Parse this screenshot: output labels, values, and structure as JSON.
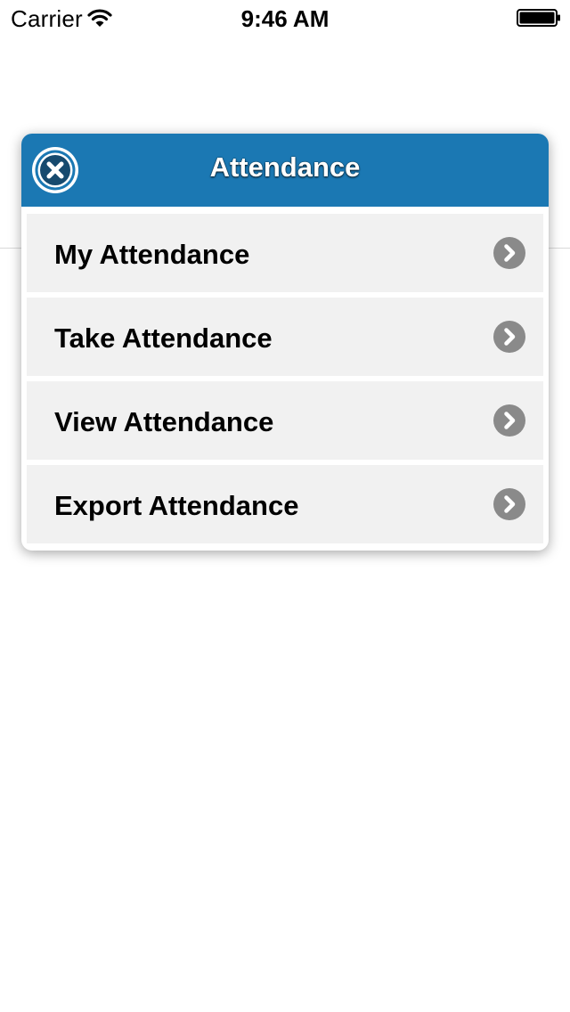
{
  "status_bar": {
    "carrier": "Carrier",
    "time": "9:46 AM",
    "wifi_icon": "wifi-icon",
    "battery_icon": "battery-full-icon"
  },
  "dialog": {
    "title": "Attendance",
    "close_icon": "close-icon",
    "header_color": "#1b78b3",
    "items": [
      {
        "label": "My Attendance",
        "icon": "chevron-right-icon"
      },
      {
        "label": "Take Attendance",
        "icon": "chevron-right-icon"
      },
      {
        "label": "View Attendance",
        "icon": "chevron-right-icon"
      },
      {
        "label": "Export Attendance",
        "icon": "chevron-right-icon"
      }
    ]
  }
}
